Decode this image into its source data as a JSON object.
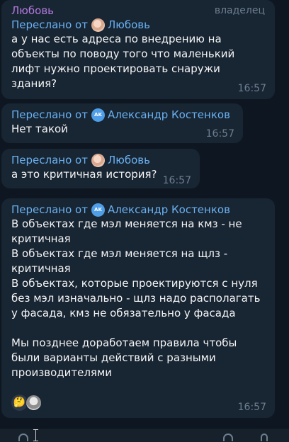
{
  "messages": [
    {
      "sender": "Любовь",
      "role": "владелец",
      "forward_prefix": "Переслано от",
      "forward_name": "Любовь",
      "text": "а у нас есть адреса по внедрению на объекты по поводу того что маленький лифт нужно проектировать снаружи здания?",
      "time": "16:57"
    },
    {
      "forward_prefix": "Переслано от",
      "forward_name": "Александр Костенков",
      "avatar_initials": "AK",
      "text": "Нет такой",
      "time": "16:57"
    },
    {
      "forward_prefix": "Переслано от",
      "forward_name": "Любовь",
      "text": "а это критичная история?",
      "time": "16:57"
    },
    {
      "forward_prefix": "Переслано от",
      "forward_name": "Александр Костенков",
      "avatar_initials": "AK",
      "text": "В объектах где мэл меняется на кмз - не критичная\nВ объектах где мэл меняется на щлз - критичная\nВ объектах, которые проектируются с нуля без мэл изначально - щлз надо располагать у фасада, кмз не обязательно у фасада\n\nМы позднее доработаем правила чтобы были варианты действий с разными производителями",
      "reaction_emoji": "🤔",
      "time": "16:57"
    }
  ],
  "colors": {
    "background": "#0e1621",
    "bubble": "#182533",
    "sender": "#b47ade",
    "forward": "#6ab2f2",
    "meta": "#6d7f8f"
  },
  "icons": [
    "avatar-photo",
    "avatar-initials",
    "thinking-face-emoji",
    "reactor-avatar"
  ]
}
